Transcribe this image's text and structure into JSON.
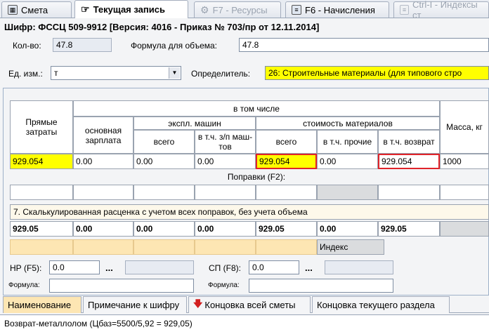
{
  "tabs": [
    {
      "label": "Смета",
      "icon": "table-icon"
    },
    {
      "label": "Текущая запись",
      "icon": "pointer-icon"
    },
    {
      "label": "F7 - Ресурсы",
      "icon": "gear-icon"
    },
    {
      "label": "F6 - Начисления",
      "icon": "document-icon"
    },
    {
      "label": "Ctrl-I - Индексы ст",
      "icon": "document-icon"
    }
  ],
  "cipher_line": "Шифр:  ФССЦ 509-9912  [Версия: 4016 - Приказ № 703/пр от 12.11.2014]",
  "form": {
    "qty_label": "Кол-во:",
    "qty_value": "47.8",
    "formula_label": "Формула для объема:",
    "formula_value": "47.8",
    "unit_label": "Ед. изм.:",
    "unit_value": "т",
    "determinant_label": "Определитель:",
    "determinant_value": "26: Строительные материалы (для типового стро"
  },
  "table": {
    "headers": {
      "direct_costs": "Прямые затраты",
      "including": "в том числе",
      "base_salary": "основная зарплата",
      "machine_ops": "экспл. машин",
      "materials_cost": "стоимость материалов",
      "total": "всего",
      "incl_machinist_salary": "в т.ч. з/п маш-тов",
      "materials_total": "всего",
      "incl_other": "в т.ч. прочие",
      "incl_return": "в т.ч. возврат",
      "mass": "Масса, кг"
    },
    "values": [
      "929.054",
      "0.00",
      "0.00",
      "0.00",
      "929.054",
      "0.00",
      "929.054",
      "1000"
    ],
    "corrections_label": "Поправки (F2):",
    "calc_label": "7. Скалькулированная расценка с учетом всех поправок, без учета объема",
    "calc_values": [
      "929.05",
      "0.00",
      "0.00",
      "0.00",
      "929.05",
      "0.00",
      "929.05"
    ],
    "index_label": "Индекс"
  },
  "overhead": {
    "hp_label": "НР (F5):",
    "hp_value": "0.0",
    "sp_label": "СП (F8):",
    "sp_value": "0.0",
    "dots": "...",
    "formula_label": "Формула:"
  },
  "bottom_tabs": [
    "Наименование",
    "Примечание к шифру",
    "Концовка всей сметы",
    "Концовка текущего раздела"
  ],
  "status_text": "Возврат-металлолом (Цбаз=5500/5,92 = 929,05)"
}
